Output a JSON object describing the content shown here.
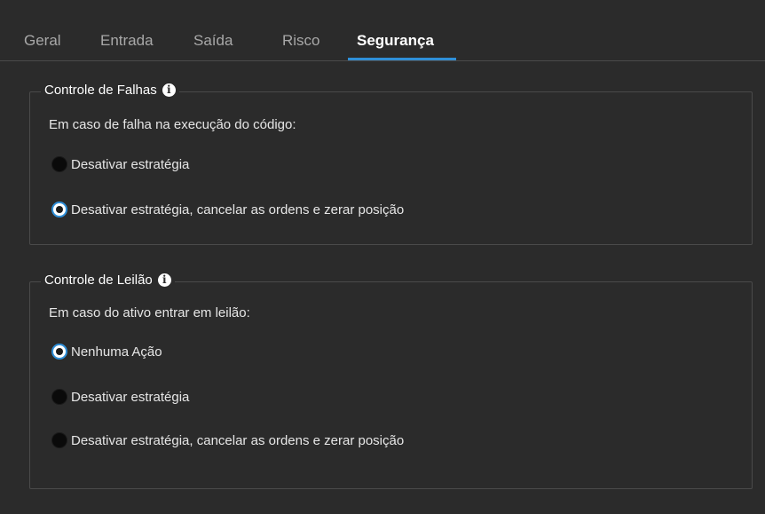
{
  "tabs": [
    {
      "label": "Geral",
      "active": false
    },
    {
      "label": "Entrada",
      "active": false
    },
    {
      "label": "Saída",
      "active": false
    },
    {
      "label": "Risco",
      "active": false
    },
    {
      "label": "Segurança",
      "active": true
    }
  ],
  "failure_control": {
    "title": "Controle de Falhas",
    "description": "Em caso de falha na execução do código:",
    "options": [
      {
        "label": "Desativar estratégia",
        "selected": false
      },
      {
        "label": "Desativar estratégia, cancelar as ordens e zerar posição",
        "selected": true
      }
    ]
  },
  "auction_control": {
    "title": "Controle de Leilão",
    "description": "Em caso do ativo entrar em leilão:",
    "options": [
      {
        "label": "Nenhuma Ação",
        "selected": true
      },
      {
        "label": "Desativar estratégia",
        "selected": false
      },
      {
        "label": "Desativar estratégia, cancelar as ordens e zerar posição",
        "selected": false
      }
    ]
  },
  "colors": {
    "background": "#2b2b2b",
    "accent": "#2f8fd8",
    "border": "#4a4a4a"
  }
}
